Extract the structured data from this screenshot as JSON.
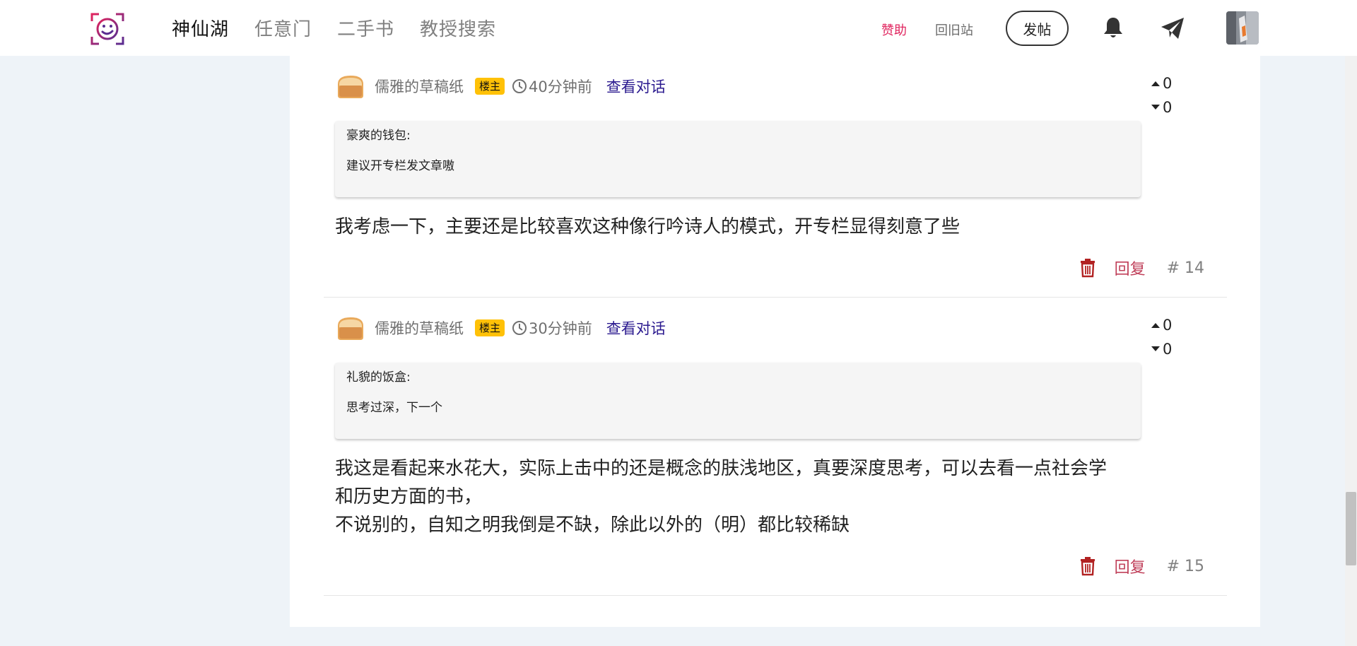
{
  "header": {
    "nav": [
      {
        "label": "神仙湖",
        "active": true
      },
      {
        "label": "任意门",
        "active": false
      },
      {
        "label": "二手书",
        "active": false
      },
      {
        "label": "教授搜索",
        "active": false
      }
    ],
    "sponsor_label": "赞助",
    "old_site_label": "回旧站",
    "post_button_label": "发帖",
    "icons": [
      "smiley-logo-icon",
      "bell-icon",
      "paper-plane-icon",
      "user-avatar"
    ]
  },
  "replies": [
    {
      "username": "儒雅的草稿纸",
      "badge": "楼主",
      "time": "40分钟前",
      "view_conversation": "查看对话",
      "votes_up": "0",
      "votes_down": "0",
      "quote_author": "豪爽的钱包:",
      "quote_text": "建议开专栏发文章嗷",
      "body_lines": [
        "我考虑一下，主要还是比较喜欢这种像行吟诗人的模式，开专栏显得刻意了些"
      ],
      "reply_label": "回复",
      "floor": "# 14"
    },
    {
      "username": "儒雅的草稿纸",
      "badge": "楼主",
      "time": "30分钟前",
      "view_conversation": "查看对话",
      "votes_up": "0",
      "votes_down": "0",
      "quote_author": "礼貌的饭盒:",
      "quote_text": "思考过深，下一个",
      "body_lines": [
        "我这是看起来水花大，实际上击中的还是概念的肤浅地区，真要深度思考，可以去看一点社会学",
        "和历史方面的书，",
        "不说别的，自知之明我倒是不缺，除此以外的（明）都比较稀缺"
      ],
      "reply_label": "回复",
      "floor": "# 15"
    }
  ],
  "colors": {
    "page_bg": "#eef3f8",
    "badge": "#ffc107",
    "reply": "#c0405a",
    "trash": "#b22222",
    "sponsor": "#e0245e",
    "link": "#2b1a8f"
  }
}
